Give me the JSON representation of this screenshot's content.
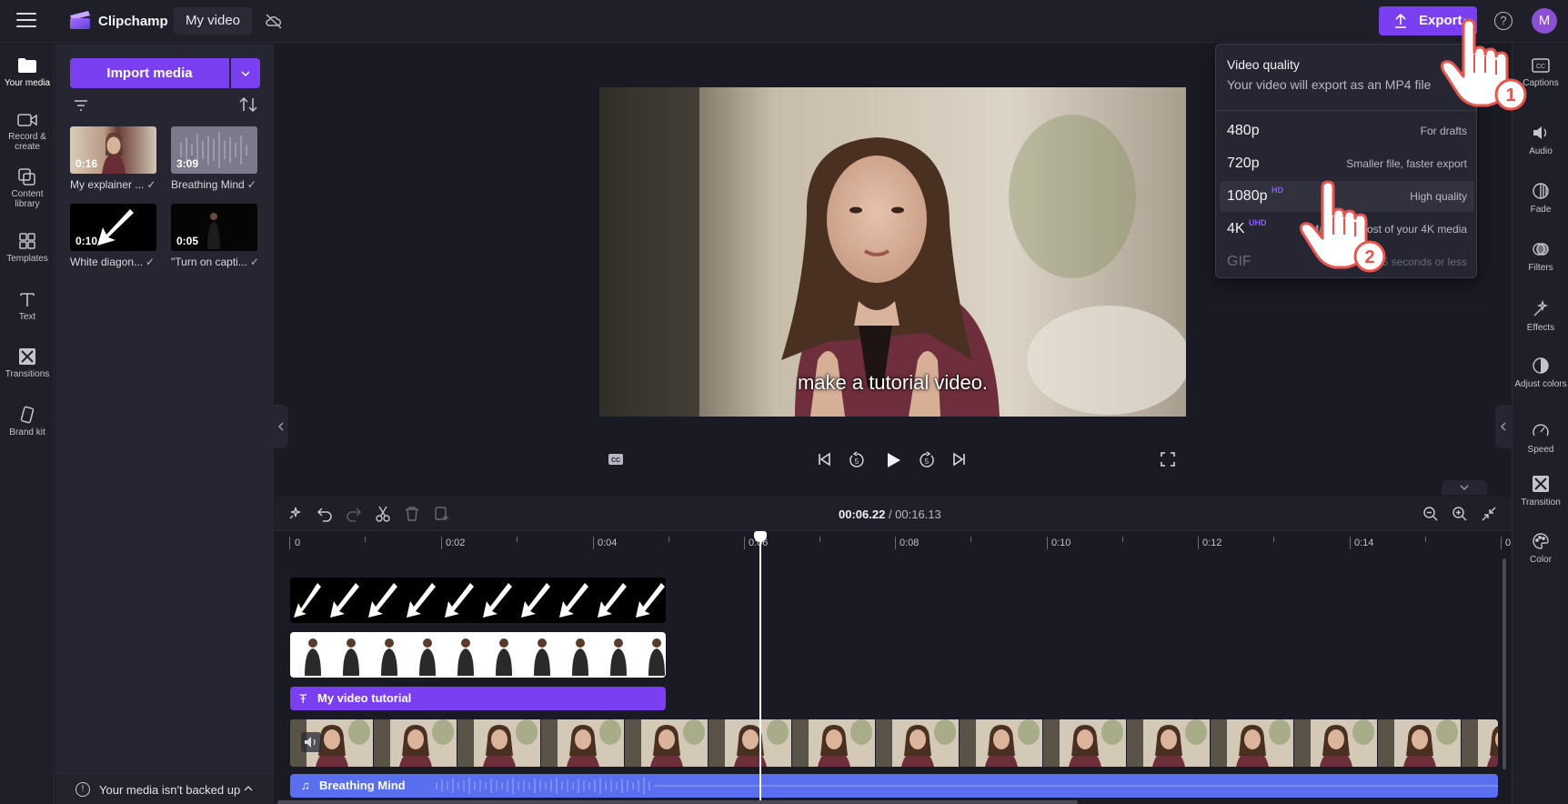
{
  "topbar": {
    "app_name": "Clipchamp",
    "project_title": "My video",
    "export_label": "Export",
    "help_symbol": "?",
    "avatar_initial": "M",
    "accent_color": "#7b3ff2"
  },
  "left_rail": [
    {
      "label": "Your media",
      "icon": "folder-icon"
    },
    {
      "label": "Record & create",
      "icon": "camera-icon"
    },
    {
      "label": "Content library",
      "icon": "library-icon"
    },
    {
      "label": "Templates",
      "icon": "templates-icon"
    },
    {
      "label": "Text",
      "icon": "text-icon"
    },
    {
      "label": "Transitions",
      "icon": "transitions-icon"
    },
    {
      "label": "Brand kit",
      "icon": "brand-kit-icon"
    }
  ],
  "media": {
    "import_label": "Import media",
    "items": [
      {
        "duration": "0:16",
        "label": "My explainer ..."
      },
      {
        "duration": "3:09",
        "label": "Breathing Mind"
      },
      {
        "duration": "0:10",
        "label": "White diagon..."
      },
      {
        "duration": "0:05",
        "label": "\"Turn on capti..."
      }
    ],
    "backup_text": "Your media isn't backed up"
  },
  "preview": {
    "caption": "make a tutorial video."
  },
  "timeline": {
    "current_time": "00:06.22",
    "total_time": "/ 00:16.13",
    "ruler": [
      "0",
      "0:02",
      "0:04",
      "0:06",
      "0:08",
      "0:10",
      "0:12",
      "0:14",
      "0"
    ],
    "text_clip": "My video tutorial",
    "audio_clip": "Breathing Mind"
  },
  "right_rail": [
    {
      "label": "Captions",
      "icon": "captions-icon"
    },
    {
      "label": "Audio",
      "icon": "speaker-icon"
    },
    {
      "label": "Fade",
      "icon": "fade-icon"
    },
    {
      "label": "Filters",
      "icon": "filters-icon"
    },
    {
      "label": "Effects",
      "icon": "effects-icon"
    },
    {
      "label": "Adjust colors",
      "icon": "adjust-colors-icon"
    },
    {
      "label": "Speed",
      "icon": "speed-icon"
    },
    {
      "label": "Transition",
      "icon": "transition-icon"
    },
    {
      "label": "Color",
      "icon": "palette-icon"
    }
  ],
  "export_dropdown": {
    "title": "Video quality",
    "subtitle": "Your video will export as an MP4 file",
    "options": [
      {
        "res": "480p",
        "badge": "",
        "desc": "For drafts"
      },
      {
        "res": "720p",
        "badge": "",
        "desc": "Smaller file, faster export"
      },
      {
        "res": "1080p",
        "badge": "HD",
        "desc": "High quality"
      },
      {
        "res": "4K",
        "badge": "UHD",
        "desc": "Make the most of your 4K media"
      },
      {
        "res": "GIF",
        "badge": "",
        "desc": "For 15 seconds or less"
      }
    ]
  },
  "annotations": {
    "step1": "1",
    "step2": "2"
  }
}
